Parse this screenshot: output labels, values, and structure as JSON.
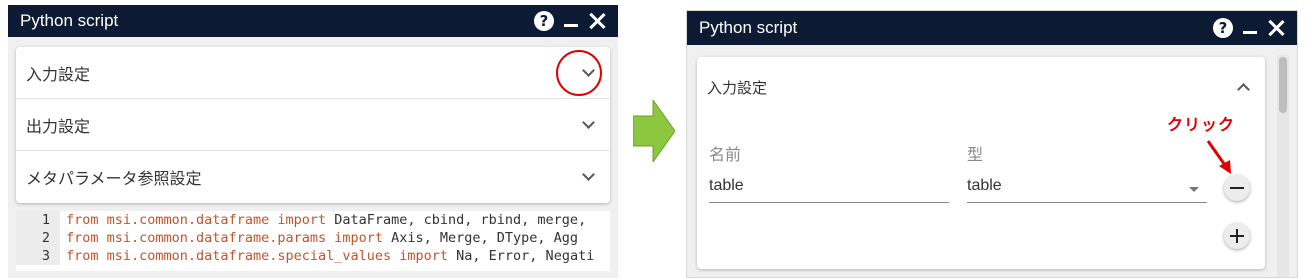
{
  "left": {
    "title": "Python script",
    "sections": [
      {
        "label": "入力設定",
        "state": "collapsed"
      },
      {
        "label": "出力設定",
        "state": "collapsed"
      },
      {
        "label": "メタパラメータ参照設定",
        "state": "collapsed"
      }
    ],
    "code_lines": [
      {
        "num": "1",
        "pre": "from msi.",
        "mod": "common.dataframe",
        "mid": " import ",
        "rest": "DataFrame, cbind, rbind, merge,"
      },
      {
        "num": "2",
        "pre": "from msi.",
        "mod": "common.dataframe.params",
        "mid": " import ",
        "rest": "Axis, Merge, DType, Agg"
      },
      {
        "num": "3",
        "pre": "from msi.",
        "mod": "common.dataframe.special_values",
        "mid": " import ",
        "rest": "Na, Error, Negati"
      }
    ]
  },
  "right": {
    "title": "Python script",
    "section_label": "入力設定",
    "name_label": "名前",
    "type_label": "型",
    "name_value": "table",
    "type_value": "table",
    "annotation": "クリック"
  },
  "colors": {
    "titlebar": "#0d1a33",
    "highlight": "#e00000",
    "arrow": "#8dc63f"
  },
  "icons": [
    "help-icon",
    "minimize-icon",
    "close-icon",
    "chevron-down-icon",
    "chevron-up-icon",
    "remove-icon",
    "add-icon"
  ]
}
